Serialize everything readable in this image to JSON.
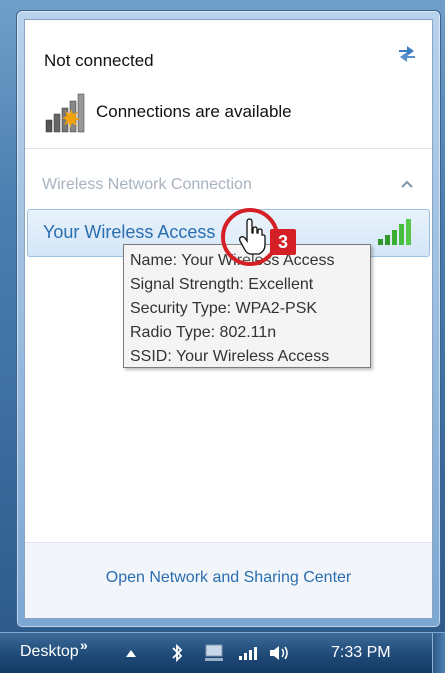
{
  "status": {
    "title": "Not connected",
    "availability": "Connections are available",
    "refresh_icon": "refresh-icon",
    "connection_icon": "signal-warning-icon"
  },
  "section": {
    "header": "Wireless Network Connection",
    "collapse_icon": "chevron-up-icon"
  },
  "network": {
    "name": "Your Wireless Access",
    "signal_icon": "wifi-bars-icon",
    "signal_bars": 5
  },
  "tooltip": {
    "lines": [
      "Name: Your Wireless Access",
      "Signal Strength: Excellent",
      "Security Type: WPA2-PSK",
      "Radio Type: 802.11n",
      "SSID: Your Wireless Access"
    ]
  },
  "annotation": {
    "step": "3",
    "accent": "#d51f26"
  },
  "footer": {
    "link": "Open Network and Sharing Center"
  },
  "taskbar": {
    "desktop_label": "Desktop",
    "overflow": "»",
    "time": "7:33 PM"
  }
}
